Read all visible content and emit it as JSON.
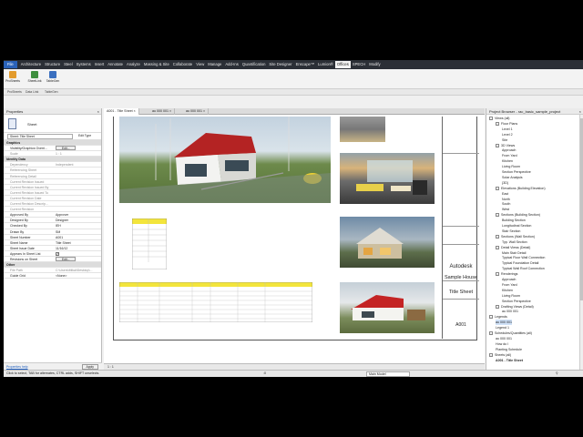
{
  "ribbon": {
    "file_tab": "File",
    "tabs": [
      "Architecture",
      "Structure",
      "Steel",
      "Systems",
      "Insert",
      "Annotate",
      "Analyze",
      "Massing & Site",
      "Collaborate",
      "View",
      "Manage",
      "Add-Ins",
      "Quantification",
      "Site Designer",
      "Enscape™",
      "Lumion®",
      "Offices",
      "SPECH",
      "Modify"
    ],
    "active_tab": "Offices",
    "buttons": [
      "ProSheets",
      "SheetLink",
      "TableGen"
    ],
    "groups": [
      "ProSheets",
      "Data Link",
      "TableGen"
    ]
  },
  "properties": {
    "title": "Properties",
    "type_name": "Sheet",
    "filter_value": "Sheet: Title Sheet",
    "edit_type": "Edit Type",
    "rows": [
      {
        "k": "Graphics",
        "v": "",
        "hdr": true
      },
      {
        "k": "Visibility/Graphics Overri...",
        "v": "Edit..."
      },
      {
        "k": "Scale",
        "v": "1 : 1",
        "gray": true
      },
      {
        "k": "Identity Data",
        "v": "",
        "hdr": true
      },
      {
        "k": "Dependency",
        "v": "Independent",
        "gray": true
      },
      {
        "k": "Referencing Sheet",
        "v": "",
        "gray": true
      },
      {
        "k": "Referencing Detail",
        "v": "",
        "gray": true
      },
      {
        "k": "Current Revision Issued",
        "v": "",
        "gray": true
      },
      {
        "k": "Current Revision Issued By",
        "v": "",
        "gray": true
      },
      {
        "k": "Current Revision Issued To",
        "v": "",
        "gray": true
      },
      {
        "k": "Current Revision Date",
        "v": "",
        "gray": true
      },
      {
        "k": "Current Revision Descrip...",
        "v": "",
        "gray": true
      },
      {
        "k": "Current Revision",
        "v": "",
        "gray": true
      },
      {
        "k": "Approved By",
        "v": "Approver"
      },
      {
        "k": "Designed By",
        "v": "Designer"
      },
      {
        "k": "Checked By",
        "v": "IEH"
      },
      {
        "k": "Drawn By",
        "v": "SM"
      },
      {
        "k": "Sheet Number",
        "v": "A001"
      },
      {
        "k": "Sheet Name",
        "v": "Title Sheet"
      },
      {
        "k": "Sheet Issue Date",
        "v": "11/16/12"
      },
      {
        "k": "Appears In Sheet List",
        "v": "✓"
      },
      {
        "k": "Revisions on Sheet",
        "v": "Edit..."
      },
      {
        "k": "Other",
        "v": "",
        "hdr": true
      },
      {
        "k": "File Path",
        "v": "C:\\Users\\Mikal\\Desktop\\...",
        "gray": true
      },
      {
        "k": "Guide Grid",
        "v": "<None>"
      }
    ],
    "help_link": "Properties help",
    "apply": "Apply"
  },
  "view_tabs": [
    "A001 - Title Sheet",
    "au 000 001",
    "au 000 001"
  ],
  "title_block": {
    "company": "Autodesk",
    "project": "Sample House",
    "sheet_name": "Title Sheet",
    "sheet_number": "A001"
  },
  "view_control": {
    "scale": "1 : 1"
  },
  "status": {
    "message": "Click to select, TAB for alternates, CTRL adds, SHIFT unselects.",
    "filter": "Main Model",
    "zero": ":0"
  },
  "project_browser": {
    "title": "Project Browser - rac_basic_sample_project",
    "items": [
      {
        "t": "Views (all)",
        "d": 0,
        "e": "-"
      },
      {
        "t": "Floor Plans",
        "d": 1,
        "e": "-"
      },
      {
        "t": "Level 1",
        "d": 2
      },
      {
        "t": "Level 2",
        "d": 2
      },
      {
        "t": "Site",
        "d": 2
      },
      {
        "t": "3D Views",
        "d": 1,
        "e": "-"
      },
      {
        "t": "Approach",
        "d": 2
      },
      {
        "t": "From Yard",
        "d": 2
      },
      {
        "t": "Kitchen",
        "d": 2
      },
      {
        "t": "Living Room",
        "d": 2
      },
      {
        "t": "Section Perspective",
        "d": 2
      },
      {
        "t": "Solar Analysis",
        "d": 2
      },
      {
        "t": "{3D}",
        "d": 2
      },
      {
        "t": "Elevations (Building Elevation)",
        "d": 1,
        "e": "-"
      },
      {
        "t": "East",
        "d": 2
      },
      {
        "t": "North",
        "d": 2
      },
      {
        "t": "South",
        "d": 2
      },
      {
        "t": "West",
        "d": 2
      },
      {
        "t": "Sections (Building Section)",
        "d": 1,
        "e": "-"
      },
      {
        "t": "Building Section",
        "d": 2
      },
      {
        "t": "Longitudinal Section",
        "d": 2
      },
      {
        "t": "Stair Section",
        "d": 2
      },
      {
        "t": "Sections (Wall Section)",
        "d": 1,
        "e": "-"
      },
      {
        "t": "Typ. Wall Section",
        "d": 2
      },
      {
        "t": "Detail Views (Detail)",
        "d": 1,
        "e": "-"
      },
      {
        "t": "Main Stair Detail",
        "d": 2
      },
      {
        "t": "Typical Floor Wall Connection",
        "d": 2
      },
      {
        "t": "Typical Foundation Detail",
        "d": 2
      },
      {
        "t": "Typical Wall Roof Connection",
        "d": 2
      },
      {
        "t": "Renderings",
        "d": 1,
        "e": "-"
      },
      {
        "t": "Approach",
        "d": 2
      },
      {
        "t": "From Yard",
        "d": 2
      },
      {
        "t": "Kitchen",
        "d": 2
      },
      {
        "t": "Living Room",
        "d": 2
      },
      {
        "t": "Section Perspective",
        "d": 2
      },
      {
        "t": "Drafting Views (Detail)",
        "d": 1,
        "e": "-"
      },
      {
        "t": "au 000 001",
        "d": 2
      },
      {
        "t": "Legends",
        "d": 0,
        "e": "-"
      },
      {
        "t": "au 000 001",
        "d": 1,
        "sel": true
      },
      {
        "t": "Legend 1",
        "d": 1
      },
      {
        "t": "Schedules/Quantities (all)",
        "d": 0,
        "e": "-"
      },
      {
        "t": "au 000 001",
        "d": 1
      },
      {
        "t": "How do I",
        "d": 1
      },
      {
        "t": "Planting Schedule",
        "d": 1
      },
      {
        "t": "Sheets (all)",
        "d": 0,
        "e": "-"
      },
      {
        "t": "A001 - Title Sheet",
        "d": 1,
        "bold": true
      }
    ]
  }
}
